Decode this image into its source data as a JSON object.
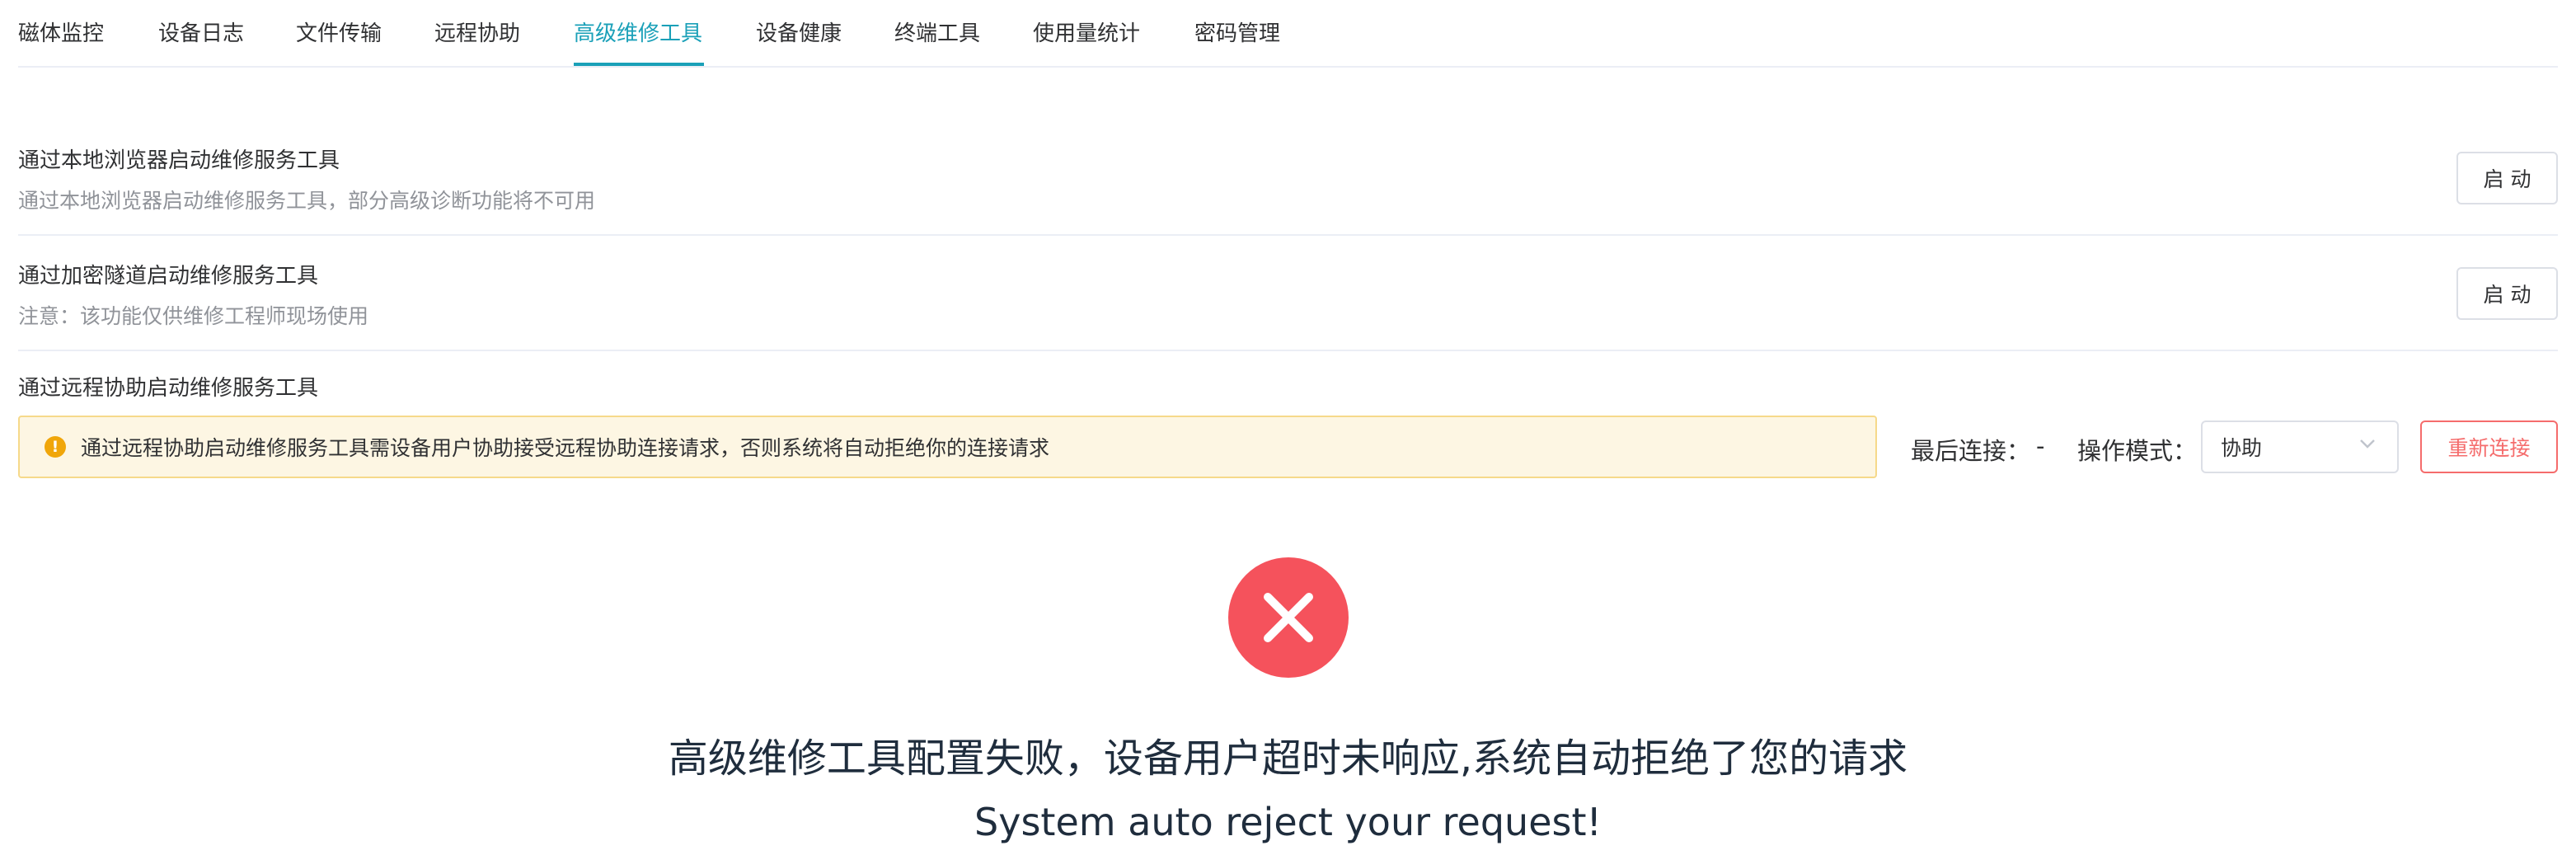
{
  "tabs": [
    {
      "label": "磁体监控"
    },
    {
      "label": "设备日志"
    },
    {
      "label": "文件传输"
    },
    {
      "label": "远程协助"
    },
    {
      "label": "高级维修工具",
      "active": true
    },
    {
      "label": "设备健康"
    },
    {
      "label": "终端工具"
    },
    {
      "label": "使用量统计"
    },
    {
      "label": "密码管理"
    }
  ],
  "local_browser": {
    "title": "通过本地浏览器启动维修服务工具",
    "description": "通过本地浏览器启动维修服务工具，部分高级诊断功能将不可用",
    "button": "启 动"
  },
  "encrypted_tunnel": {
    "title": "通过加密隧道启动维修服务工具",
    "description": "注意：该功能仅供维修工程师现场使用",
    "button": "启 动"
  },
  "remote_assist": {
    "title": "通过远程协助启动维修服务工具",
    "alert": "通过远程协助启动维修服务工具需设备用户协助接受远程协助连接请求，否则系统将自动拒绝你的连接请求",
    "last_connection_label": "最后连接：",
    "last_connection_value": "-",
    "mode_label": "操作模式：",
    "mode_value": "协助",
    "reconnect_button": "重新连接"
  },
  "result": {
    "icon": "error-x-icon",
    "title": "高级维修工具配置失败，设备用户超时未响应,系统自动拒绝了您的请求",
    "subtitle": "System auto reject your request!"
  },
  "colors": {
    "accent": "#1aa0b8",
    "danger": "#f56c6c",
    "error_circle": "#f5525c",
    "warning": "#f0a60a",
    "alert_bg": "#fdf6e3"
  }
}
